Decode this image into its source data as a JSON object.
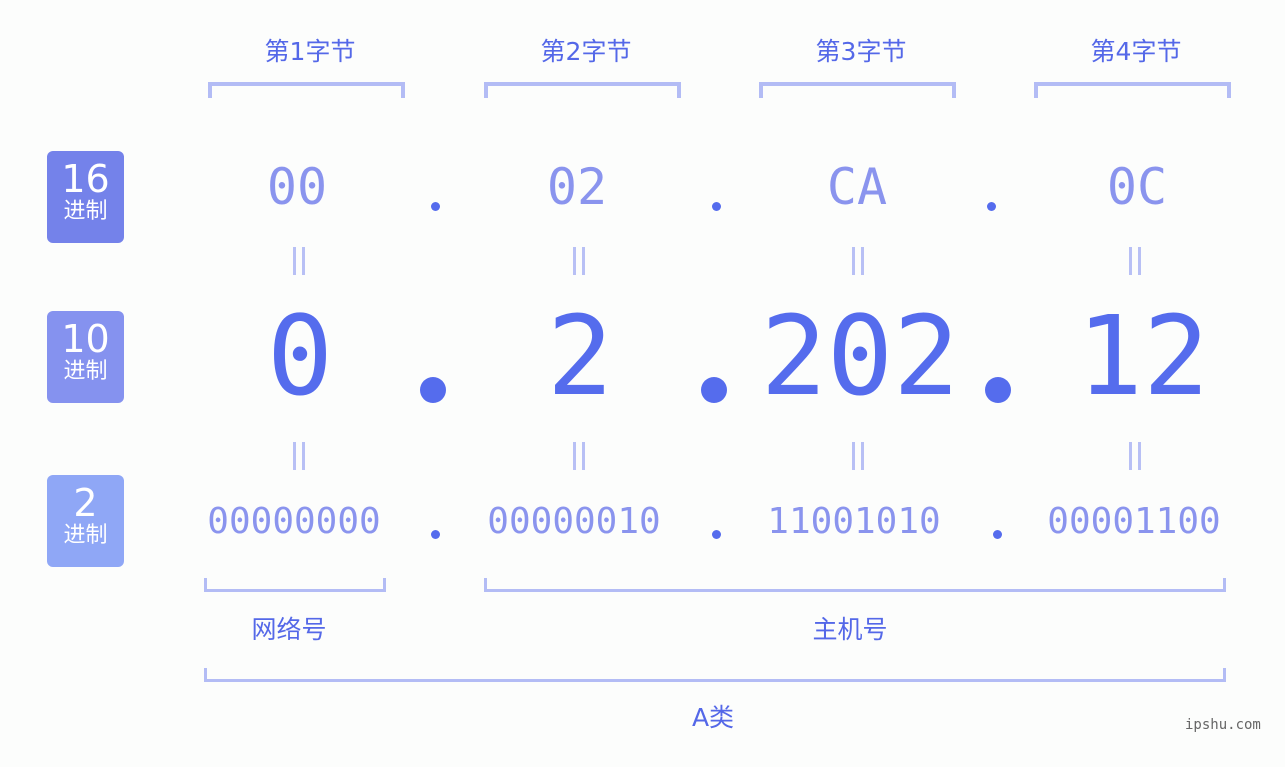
{
  "bytes": [
    {
      "title": "第1字节",
      "hex": "00",
      "dec": "0",
      "bin": "00000000"
    },
    {
      "title": "第2字节",
      "hex": "02",
      "dec": "2",
      "bin": "00000010"
    },
    {
      "title": "第3字节",
      "hex": "CA",
      "dec": "202",
      "bin": "11001010"
    },
    {
      "title": "第4字节",
      "hex": "0C",
      "dec": "12",
      "bin": "00001100"
    }
  ],
  "rows": {
    "hex": {
      "num": "16",
      "label": "进制",
      "color": "#7482ea"
    },
    "dec": {
      "num": "10",
      "label": "进制",
      "color": "#8592ef"
    },
    "bin": {
      "num": "2",
      "label": "进制",
      "color": "#8fa7f6"
    }
  },
  "segments": {
    "network": "网络号",
    "host": "主机号",
    "class": "A类"
  },
  "watermark": "ipshu.com",
  "colors": {
    "accent": "#556ced",
    "light": "#8a94ee",
    "bracket": "#b3bcf5"
  }
}
